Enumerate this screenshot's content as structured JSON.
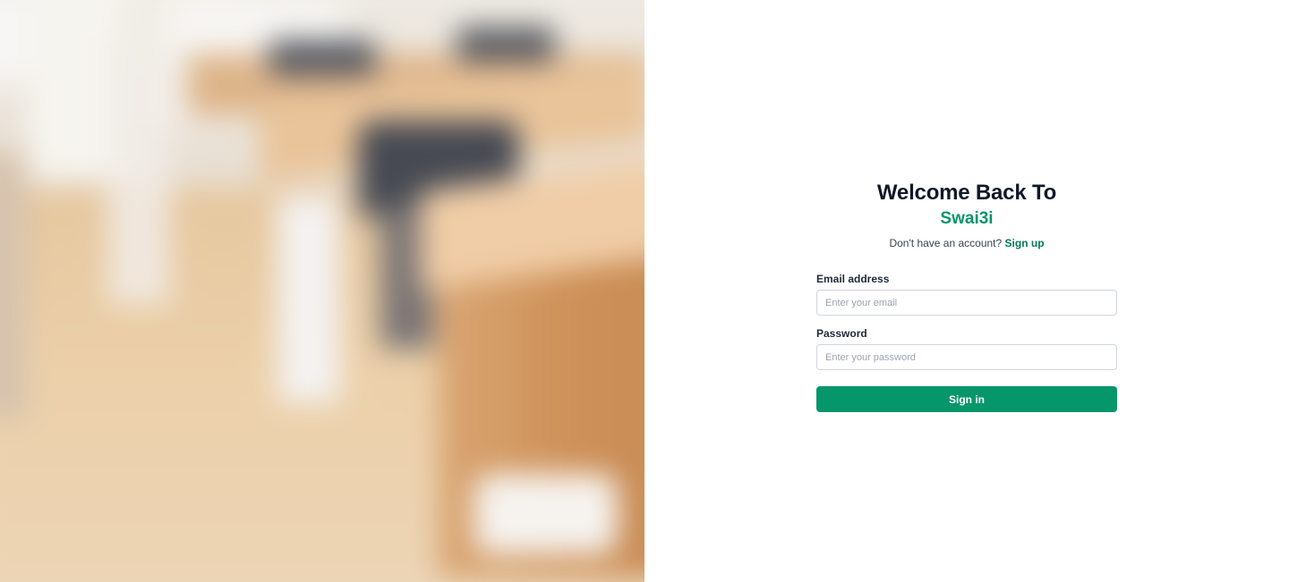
{
  "login": {
    "title": "Welcome Back To",
    "brand": "Swai3i",
    "signup_prompt": "Don't have an account?",
    "signup_link": "Sign up",
    "email_label": "Email address",
    "email_placeholder": "Enter your email",
    "password_label": "Password",
    "password_placeholder": "Enter your password",
    "submit_label": "Sign in"
  },
  "colors": {
    "accent": "#059669",
    "title": "#111827",
    "border": "#d1d5db"
  }
}
